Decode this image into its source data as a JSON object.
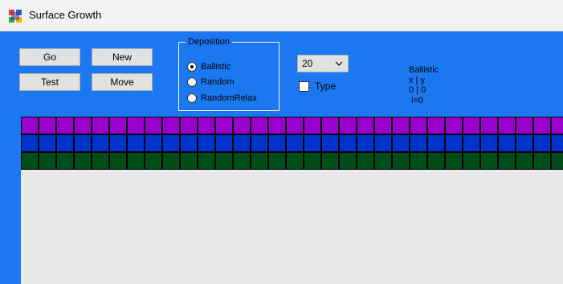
{
  "window": {
    "title": "Surface Growth"
  },
  "buttons": {
    "go": "Go",
    "new": "New",
    "test": "Test",
    "move": "Move"
  },
  "deposition": {
    "legend": "Deposition",
    "options": [
      {
        "label": "Ballistic",
        "checked": true
      },
      {
        "label": "Random",
        "checked": false
      },
      {
        "label": "RandomRelax",
        "checked": false
      }
    ]
  },
  "size_select": {
    "value": "20"
  },
  "type_checkbox": {
    "label": "Type",
    "checked": false
  },
  "info": {
    "mode": "Ballistic",
    "header": "x  |  y",
    "values": "0  |  0",
    "iteration": "i=0"
  },
  "surface": {
    "columns_visible": 31,
    "layers": [
      {
        "name": "purple",
        "color": "#9900cc"
      },
      {
        "name": "blue",
        "color": "#0033cc"
      },
      {
        "name": "green",
        "color": "#004d1a"
      }
    ]
  },
  "colors": {
    "window_bg": "#1c78f0",
    "canvas_bg": "#e9e9e9"
  }
}
